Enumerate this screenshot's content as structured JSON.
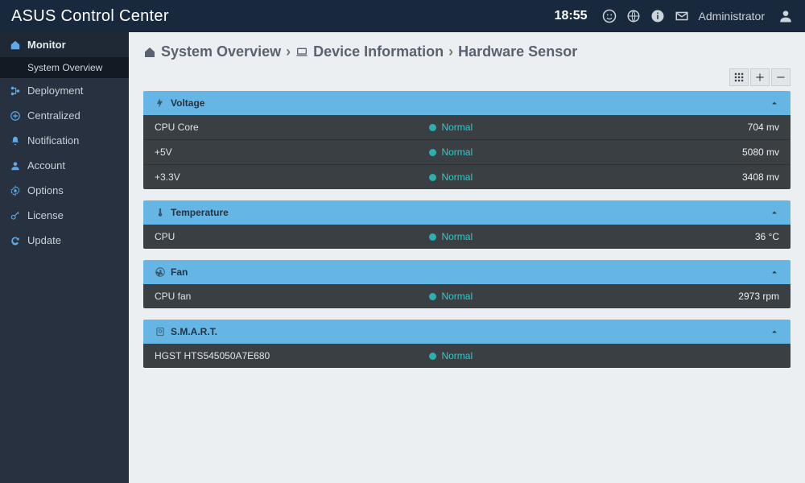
{
  "header": {
    "brand": "ASUS Control Center",
    "time": "18:55",
    "user": "Administrator"
  },
  "sidebar": {
    "items": [
      {
        "label": "Monitor",
        "icon": "home"
      },
      {
        "label": "Deployment",
        "icon": "tree"
      },
      {
        "label": "Centralized",
        "icon": "plus-circle"
      },
      {
        "label": "Notification",
        "icon": "bell"
      },
      {
        "label": "Account",
        "icon": "user"
      },
      {
        "label": "Options",
        "icon": "gear"
      },
      {
        "label": "License",
        "icon": "key"
      },
      {
        "label": "Update",
        "icon": "refresh"
      }
    ],
    "sub": {
      "label": "System Overview"
    }
  },
  "breadcrumb": {
    "a": "System Overview",
    "b": "Device Information",
    "c": "Hardware Sensor"
  },
  "panels": {
    "voltage": {
      "title": "Voltage",
      "rows": [
        {
          "name": "CPU Core",
          "status": "Normal",
          "value": "704 mv"
        },
        {
          "name": "+5V",
          "status": "Normal",
          "value": "5080 mv"
        },
        {
          "name": "+3.3V",
          "status": "Normal",
          "value": "3408 mv"
        }
      ]
    },
    "temperature": {
      "title": "Temperature",
      "rows": [
        {
          "name": "CPU",
          "status": "Normal",
          "value": "36 °C"
        }
      ]
    },
    "fan": {
      "title": "Fan",
      "rows": [
        {
          "name": "CPU fan",
          "status": "Normal",
          "value": "2973 rpm"
        }
      ]
    },
    "smart": {
      "title": "S.M.A.R.T.",
      "rows": [
        {
          "name": "HGST HTS545050A7E680",
          "status": "Normal",
          "value": ""
        }
      ]
    }
  }
}
